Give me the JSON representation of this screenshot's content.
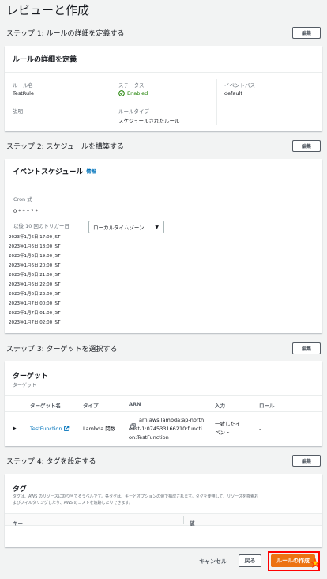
{
  "page": {
    "title": "レビューと作成"
  },
  "edit_label": "編集",
  "step1": {
    "title": "ステップ 1: ルールの詳細を定義する",
    "panel_title": "ルールの詳細を定義",
    "rule_name_label": "ルール名",
    "rule_name_value": "TestRule",
    "description_label": "説明",
    "status_label": "ステータス",
    "status_value": "Enabled",
    "rule_type_label": "ルールタイプ",
    "rule_type_value": "スケジュールされたルール",
    "event_bus_label": "イベントバス",
    "event_bus_value": "default"
  },
  "step2": {
    "title": "ステップ 2: スケジュールを構築する",
    "panel_title": "イベントスケジュール",
    "info_label": "情報",
    "cron_label": "Cron 式",
    "cron_value": "0 * * * ? *",
    "next_triggers_label": "以後 10 回のトリガー日",
    "timezone_select": "ローカルタイムゾーン",
    "triggers": [
      "2023年1月6日 17:00 JST",
      "2023年1月6日 18:00 JST",
      "2023年1月6日 19:00 JST",
      "2023年1月6日 20:00 JST",
      "2023年1月6日 21:00 JST",
      "2023年1月6日 22:00 JST",
      "2023年1月6日 23:00 JST",
      "2023年1月7日 00:00 JST",
      "2023年1月7日 01:00 JST",
      "2023年1月7日 02:00 JST"
    ]
  },
  "step3": {
    "title": "ステップ 3: ターゲットを選択する",
    "panel_title": "ターゲット",
    "panel_subtitle": "ターゲット",
    "columns": [
      "ターゲット名",
      "タイプ",
      "ARN",
      "入力",
      "ロール"
    ],
    "row": {
      "name": "TestFunction",
      "type": "Lambda 関数",
      "arn_line1": "arn:aws:lambda:ap-north",
      "arn_line2": "east-1:074533166210:functi",
      "arn_line3": "on:TestFunction",
      "input_line1": "一致したイ",
      "input_line2": "ベント",
      "role": "-"
    }
  },
  "step4": {
    "title": "ステップ 4: タグを設定する",
    "panel_title": "タグ",
    "description_line1": "タグは、AWS のリソースに割り当てるラベルです。各タグは、キーとオプションの値で構成されます。タグを使用して、リソースを検索お",
    "description_line2": "よびフィルタリングしたり、AWS のコストを追跡したりできます。",
    "key_col": "キー",
    "value_col": "値"
  },
  "footer": {
    "cancel": "キャンセル",
    "back": "戻る",
    "create": "ルールの作成"
  },
  "colors": {
    "primary": "#ec7211",
    "link": "#0073bb",
    "success": "#1d8102",
    "highlight": "#ff0000"
  }
}
